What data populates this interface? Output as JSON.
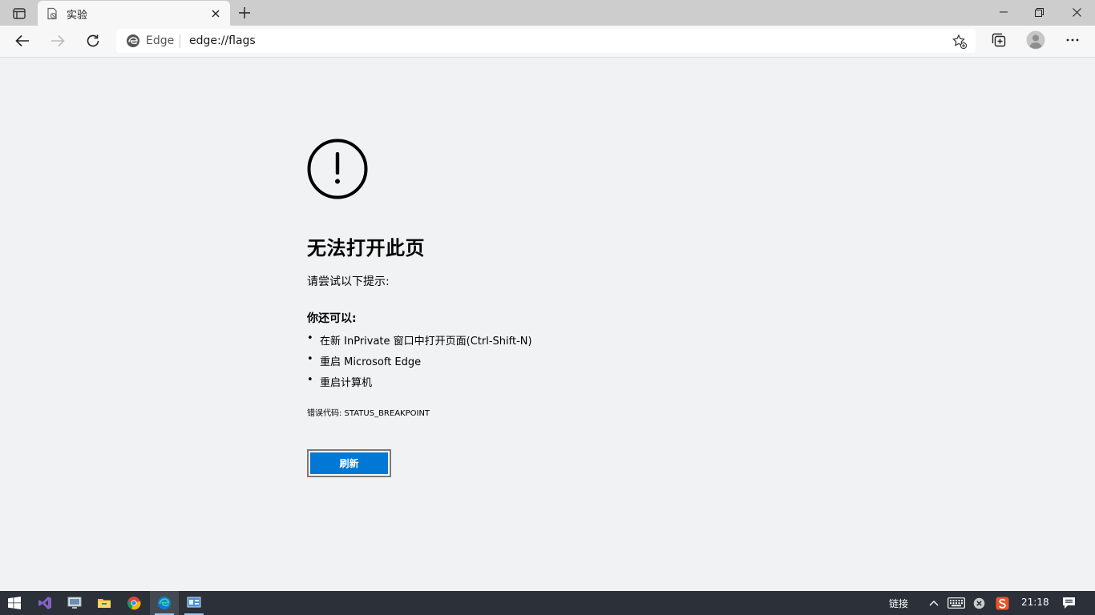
{
  "tab": {
    "title": "实验"
  },
  "address_bar": {
    "site_label": "Edge",
    "url": "edge://flags"
  },
  "error": {
    "title": "无法打开此页",
    "suggest_heading": "请尝试以下提示:",
    "also_heading": "你还可以:",
    "tips": [
      "在新 InPrivate 窗口中打开页面(Ctrl-Shift-N)",
      "重启 Microsoft Edge",
      "重启计算机"
    ],
    "error_code": "错误代码: STATUS_BREAKPOINT",
    "refresh_label": "刷新"
  },
  "taskbar": {
    "apps": [
      "start-icon",
      "visual-studio-icon",
      "remote-desktop-icon",
      "file-explorer-icon",
      "chrome-icon",
      "edge-icon",
      "control-panel-icon"
    ],
    "active_app": "edge-icon",
    "tray_links_label": "链接",
    "clock": "21:18"
  },
  "colors": {
    "accent": "#0078d4",
    "page_background": "#f1f2f4",
    "taskbar": "#2b3039",
    "tabstrip": "#cdcdcd"
  }
}
